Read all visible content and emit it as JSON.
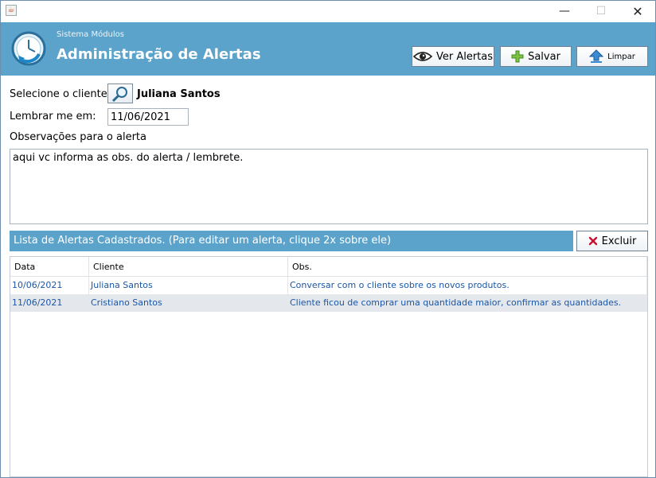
{
  "window": {
    "min": "—",
    "max": "☐",
    "close": "✕"
  },
  "header": {
    "subtitle": "Sistema Módulos",
    "title": "Administração de Alertas",
    "buttons": {
      "ver": "Ver Alertas",
      "salvar": "Salvar",
      "limpar": "Limpar"
    }
  },
  "form": {
    "cliente_label": "Selecione o cliente:",
    "cliente_name": "Juliana Santos",
    "lembrar_label": "Lembrar me em:",
    "lembrar_value": "11/06/2021",
    "obs_label": "Observações para o alerta",
    "obs_value": "aqui vc informa as obs. do alerta / lembrete."
  },
  "list": {
    "title": "Lista de Alertas Cadastrados. (Para editar um alerta, clique 2x sobre ele)",
    "excluir": "Excluir",
    "columns": [
      "Data",
      "Cliente",
      "Obs."
    ],
    "rows": [
      {
        "data": "10/06/2021",
        "cliente": "Juliana Santos",
        "obs": "Conversar com o cliente sobre os novos produtos."
      },
      {
        "data": "11/06/2021",
        "cliente": "Cristiano Santos",
        "obs": "Cliente ficou de comprar uma quantidade maior, confirmar as quantidades."
      }
    ]
  },
  "colors": {
    "header_bg": "#5ba3cb",
    "row_text": "#1a56a8",
    "selected_row": "#e4e8ed"
  },
  "icons": {
    "logo": "clock-icon",
    "ver": "eye-icon",
    "salvar": "plus-icon",
    "limpar": "arrow-up-icon",
    "excluir": "x-icon",
    "search": "magnifier-icon"
  }
}
